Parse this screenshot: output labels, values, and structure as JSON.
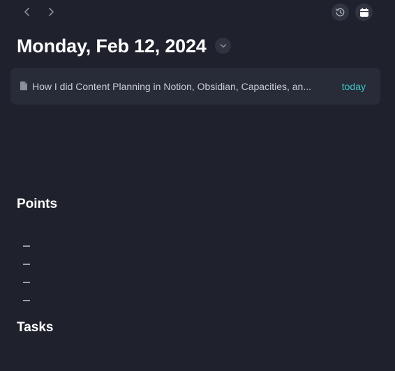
{
  "toolbar": {
    "back_icon": "chevron-left-icon",
    "forward_icon": "chevron-right-icon",
    "history_icon": "history-icon",
    "calendar_icon": "calendar-icon"
  },
  "page": {
    "title": "Monday, Feb 12, 2024",
    "title_menu_icon": "chevron-down-icon"
  },
  "reference": {
    "icon": "document-icon",
    "title": "How I did Content Planning in Notion, Obsidian, Capacities, an...",
    "badge": "today"
  },
  "sections": {
    "points": {
      "heading": "Points",
      "bullet_count": 4,
      "bullets": [
        "",
        "",
        "",
        ""
      ]
    },
    "tasks": {
      "heading": "Tasks"
    }
  },
  "colors": {
    "background": "#1f222c",
    "card": "#282c38",
    "accent": "#41c4c4",
    "text": "#ffffff",
    "muted": "#9aa0ab"
  }
}
